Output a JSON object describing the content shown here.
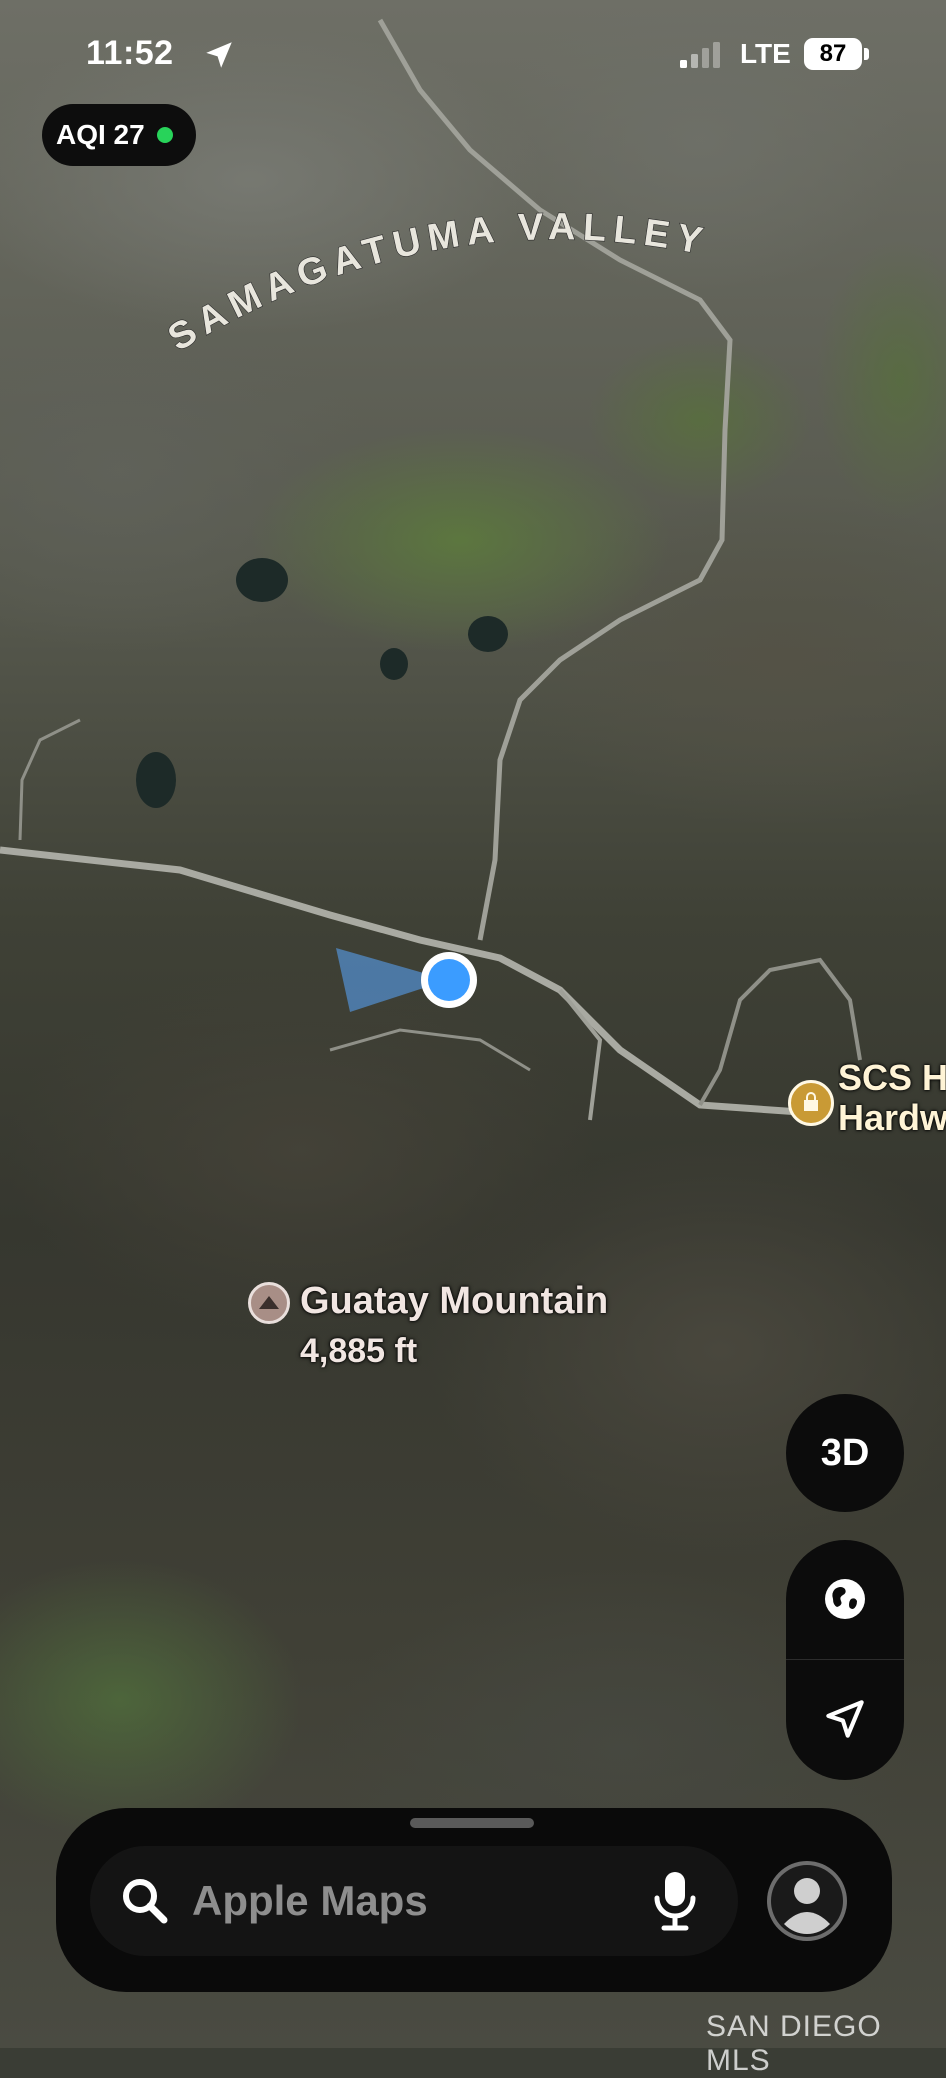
{
  "status_bar": {
    "time": "11:52",
    "network": "LTE",
    "battery": "87"
  },
  "aqi": {
    "label": "AQI 27",
    "dot_color": "#28d35a"
  },
  "map": {
    "region_label": "SAMAGATUMA VALLEY",
    "poi_shop": {
      "name": "SCS H\nHardw",
      "icon": "bag-icon"
    },
    "mountain": {
      "name": "Guatay Mountain",
      "elevation": "4,885 ft",
      "icon": "mountain-peak-icon"
    },
    "watermark": "SAN DIEGO MLS"
  },
  "controls": {
    "three_d_label": "3D",
    "globe_icon": "globe-icon",
    "location_icon": "location-arrow-icon"
  },
  "search": {
    "placeholder": "Apple Maps",
    "search_icon": "search-icon",
    "mic_icon": "microphone-icon",
    "account_icon": "account-icon"
  }
}
